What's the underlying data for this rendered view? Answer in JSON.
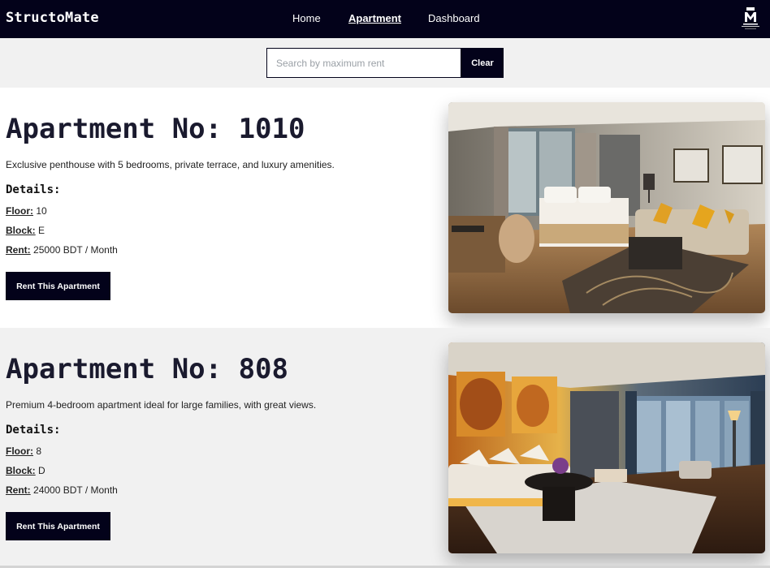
{
  "navbar": {
    "brand": "StructoMate",
    "links": {
      "home": "Home",
      "apartment": "Apartment",
      "dashboard": "Dashboard"
    },
    "logo_text": "StructoMate"
  },
  "search": {
    "placeholder": "Search by maximum rent",
    "value": "",
    "clear_label": "Clear"
  },
  "apartments": [
    {
      "title": "Apartment No: 1010",
      "description": "Exclusive penthouse with 5 bedrooms, private terrace, and luxury amenities.",
      "details_heading": "Details:",
      "floor_label": "Floor:",
      "floor": "10",
      "block_label": "Block:",
      "block": "E",
      "rent_label": "Rent:",
      "rent": "25000 BDT / Month",
      "button_label": "Rent This Apartment"
    },
    {
      "title": "Apartment No: 808",
      "description": "Premium 4-bedroom apartment ideal for large families, with great views.",
      "details_heading": "Details:",
      "floor_label": "Floor:",
      "floor": "8",
      "block_label": "Block:",
      "block": "D",
      "rent_label": "Rent:",
      "rent": "24000 BDT / Month",
      "button_label": "Rent This Apartment"
    }
  ],
  "colors": {
    "nav_bg": "#03021a",
    "button_bg": "#03021a",
    "card_alt_bg": "#f1f1f1"
  }
}
